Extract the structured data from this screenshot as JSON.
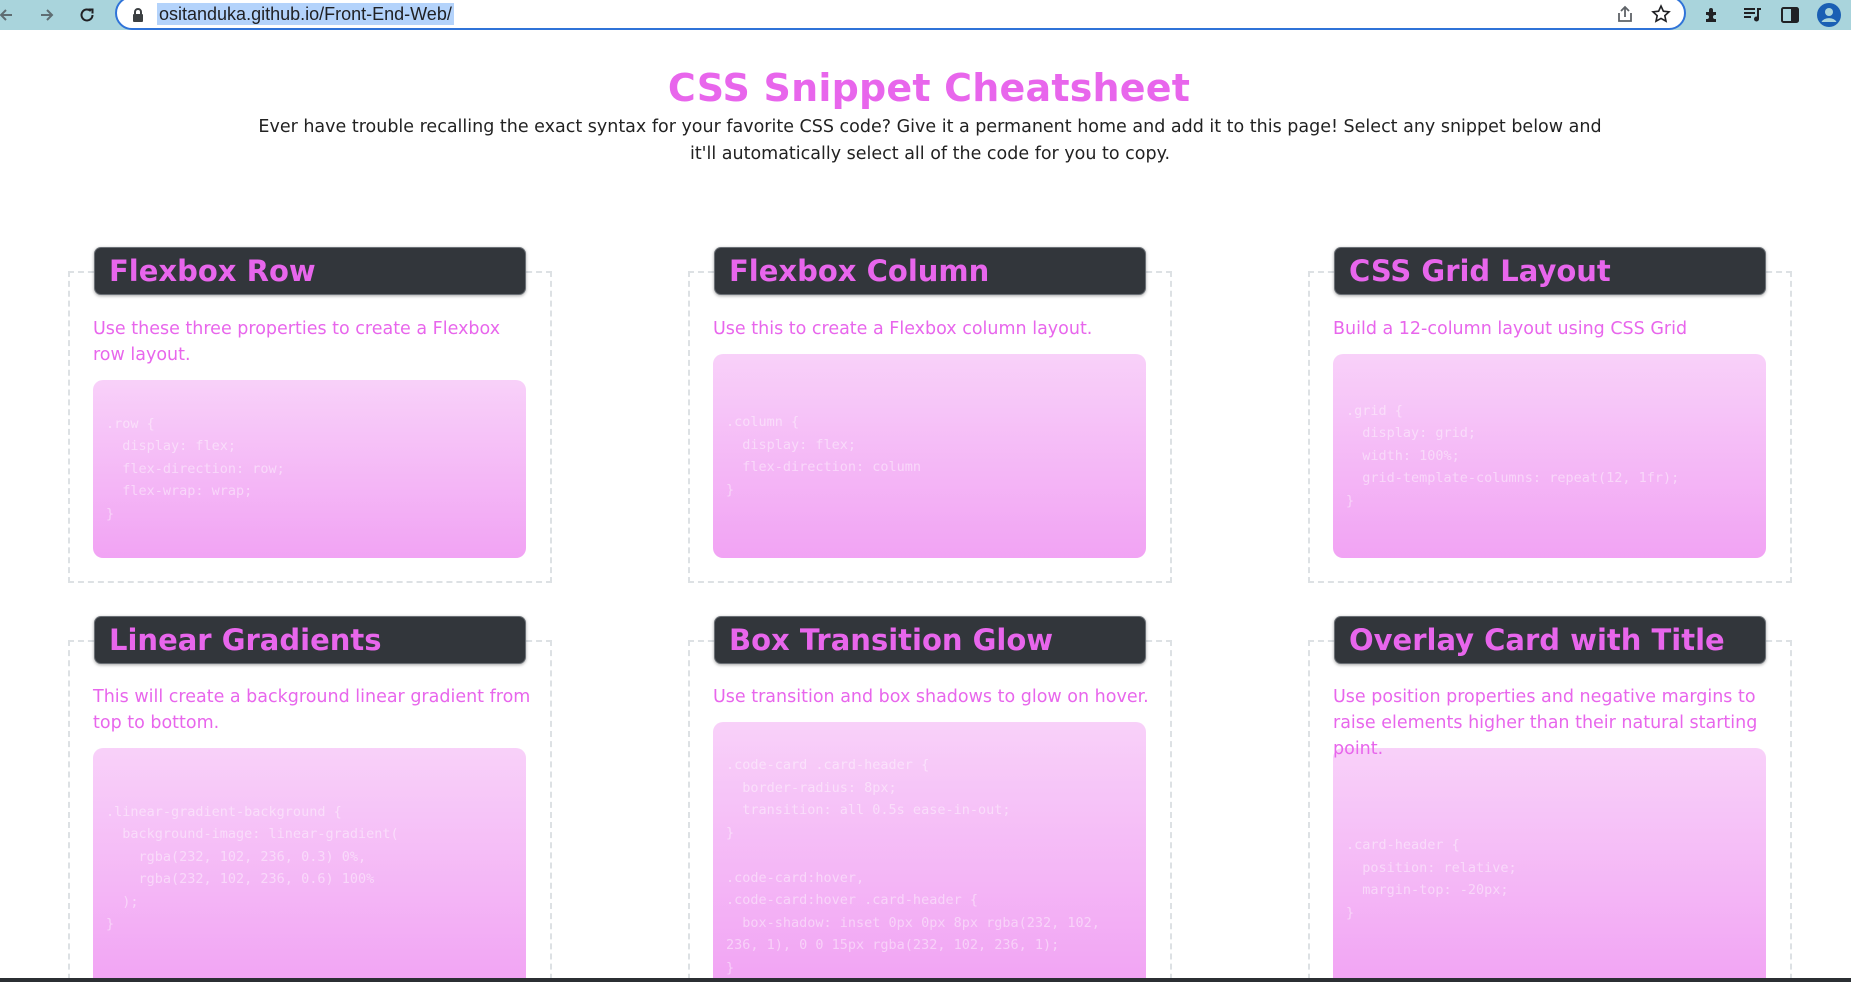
{
  "browser": {
    "url": "ositanduka.github.io/Front-End-Web/",
    "back_icon": "arrow-left-icon",
    "forward_icon": "arrow-right-icon",
    "reload_icon": "reload-icon",
    "lock_icon": "lock-icon",
    "share_icon": "share-icon",
    "bookmark_icon": "star-icon",
    "extensions_icon": "puzzle-icon",
    "media_icon": "media-queue-icon",
    "sidepanel_icon": "side-panel-icon",
    "profile_icon": "profile-icon",
    "toolbar_color": "#a9d4dc",
    "omnibox_border": "#2f73d8"
  },
  "page": {
    "title": "CSS Snippet Cheatsheet",
    "intro": "Ever have trouble recalling the exact syntax for your favorite CSS code? Give it a permanent home and add it to this page! Select any snippet below and it'll automatically select all of the code for you to copy.",
    "accent_color": "#e866ec",
    "header_bg": "#32363b"
  },
  "cards": [
    {
      "title": "Flexbox Row",
      "description": "Use these three properties to create a Flexbox row layout.",
      "code": ".row {\n  display: flex;\n  flex-direction: row;\n  flex-wrap: wrap;\n}"
    },
    {
      "title": "Flexbox Column",
      "description": "Use this to create a Flexbox column layout.",
      "code": ".column {\n  display: flex;\n  flex-direction: column\n}"
    },
    {
      "title": "CSS Grid Layout",
      "description": "Build a 12-column layout using CSS Grid",
      "code": ".grid {\n  display: grid;\n  width: 100%;\n  grid-template-columns: repeat(12, 1fr);\n}"
    },
    {
      "title": "Linear Gradients",
      "description": "This will create a background linear gradient from top to bottom.",
      "code": ".linear-gradient-background {\n  background-image: linear-gradient(\n    rgba(232, 102, 236, 0.3) 0%,\n    rgba(232, 102, 236, 0.6) 100%\n  );\n}"
    },
    {
      "title": "Box Transition Glow",
      "description": "Use transition and box shadows to glow on hover.",
      "code": ".code-card .card-header {\n  border-radius: 8px;\n  transition: all 0.5s ease-in-out;\n}\n\n.code-card:hover,\n.code-card:hover .card-header {\n  box-shadow: inset 0px 0px 8px rgba(232, 102,\n236, 1), 0 0 15px rgba(232, 102, 236, 1);\n}"
    },
    {
      "title": "Overlay Card with Title",
      "description": "Use position properties and negative margins to raise elements higher than their natural starting point.",
      "code": ".card-header {\n  position: relative;\n  margin-top: -20px;\n}"
    }
  ]
}
